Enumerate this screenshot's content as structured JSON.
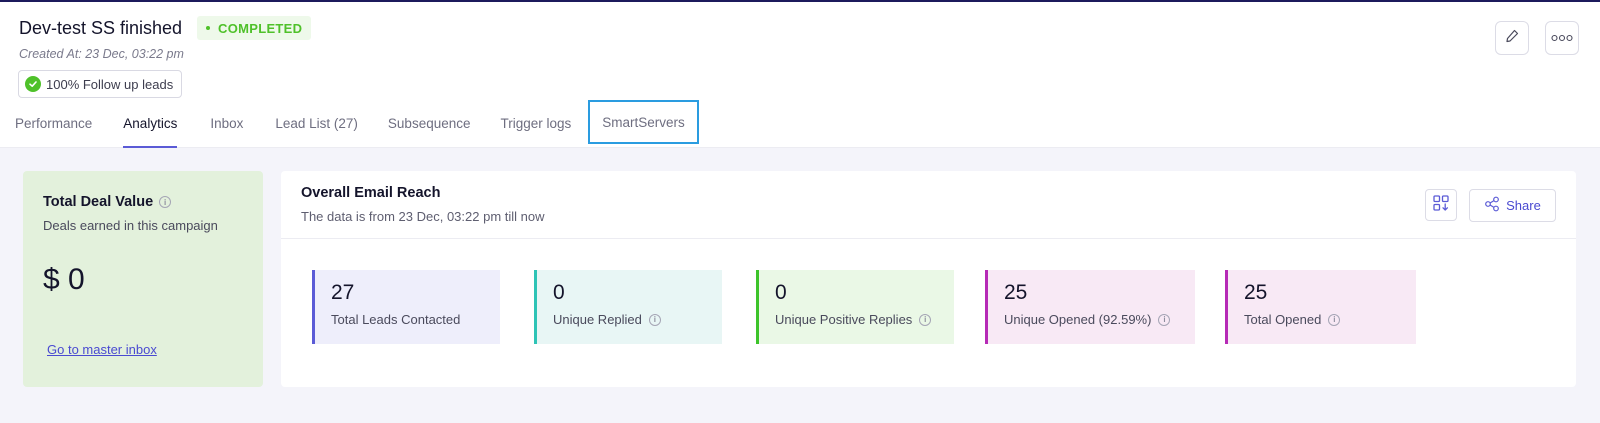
{
  "campaign": {
    "title": "Dev-test SS finished",
    "status": "COMPLETED",
    "created_at": "Created At: 23 Dec, 03:22 pm",
    "followup_badge": "100% Follow up leads"
  },
  "actions": {
    "edit_icon": "pencil-icon",
    "more_icon": "more-horizontal-icon"
  },
  "tabs": [
    {
      "label": "Performance",
      "active": false
    },
    {
      "label": "Analytics",
      "active": true
    },
    {
      "label": "Inbox",
      "active": false
    },
    {
      "label": "Lead List (27)",
      "active": false
    },
    {
      "label": "Subsequence",
      "active": false
    },
    {
      "label": "Trigger logs",
      "active": false
    },
    {
      "label": "SmartServers",
      "active": false,
      "focused": true
    }
  ],
  "deal": {
    "title": "Total Deal Value",
    "subtitle": "Deals earned in this campaign",
    "value": "$ 0",
    "link": "Go to master inbox"
  },
  "reach": {
    "title": "Overall Email Reach",
    "subtitle": "The data is from 23 Dec, 03:22 pm till now",
    "share_label": "Share",
    "stats": [
      {
        "value": "27",
        "label": "Total Leads Contacted",
        "info": false,
        "accent": "#5b5bd6",
        "bg": "#eeeefb"
      },
      {
        "value": "0",
        "label": "Unique Replied",
        "info": true,
        "accent": "#2ec4b6",
        "bg": "#e8f6f5"
      },
      {
        "value": "0",
        "label": "Unique Positive Replies",
        "info": true,
        "accent": "#3cc42a",
        "bg": "#eaf8e6"
      },
      {
        "value": "25",
        "label": "Unique Opened (92.59%)",
        "info": true,
        "accent": "#b62ab6",
        "bg": "#f8e9f5"
      },
      {
        "value": "25",
        "label": "Total Opened",
        "info": true,
        "accent": "#b62ab6",
        "bg": "#f8e9f5"
      }
    ]
  },
  "colors": {
    "accent": "#5b5bd6",
    "success": "#4fc12a",
    "link": "#4a4ad1",
    "focus": "#2a9ce0"
  }
}
